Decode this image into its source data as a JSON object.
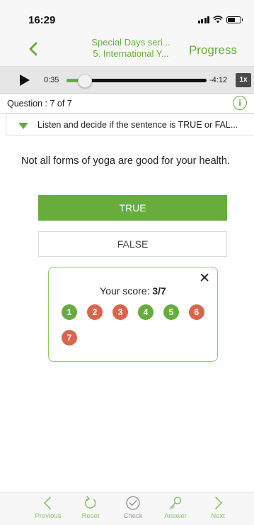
{
  "status_bar": {
    "time": "16:29"
  },
  "nav": {
    "title_line1": "Special Days seri...",
    "title_line2": "5. International Y...",
    "progress_label": "Progress"
  },
  "player": {
    "elapsed": "0:35",
    "remaining": "-4:12",
    "speed": "1x",
    "progress_fraction": 0.12
  },
  "question_bar": {
    "label": "Question : 7 of 7",
    "info_icon": "i"
  },
  "instruction": {
    "text": "Listen and decide if the sentence is TRUE or FAL..."
  },
  "question": {
    "text": "Not all forms of yoga are good for your health."
  },
  "options": [
    {
      "label": "TRUE",
      "selected": true
    },
    {
      "label": "FALSE",
      "selected": false
    }
  ],
  "score": {
    "label": "Your score:",
    "value": "3/7",
    "close_icon": "✕",
    "badges": [
      {
        "num": "1",
        "status": "correct"
      },
      {
        "num": "2",
        "status": "wrong"
      },
      {
        "num": "3",
        "status": "wrong"
      },
      {
        "num": "4",
        "status": "correct"
      },
      {
        "num": "5",
        "status": "correct"
      },
      {
        "num": "6",
        "status": "wrong"
      },
      {
        "num": "7",
        "status": "wrong"
      }
    ]
  },
  "bottom_tabs": [
    {
      "label": "Previous",
      "icon": "chevron-left-icon",
      "color": "green"
    },
    {
      "label": "Reset",
      "icon": "reset-icon",
      "color": "green"
    },
    {
      "label": "Check",
      "icon": "check-icon",
      "color": "gray"
    },
    {
      "label": "Answer",
      "icon": "key-icon",
      "color": "green"
    },
    {
      "label": "Next",
      "icon": "chevron-right-icon",
      "color": "green"
    }
  ],
  "colors": {
    "accent": "#67ad3e",
    "wrong": "#d9654d",
    "tab_green": "#8dc36b",
    "tab_gray": "#9a9a9a"
  }
}
